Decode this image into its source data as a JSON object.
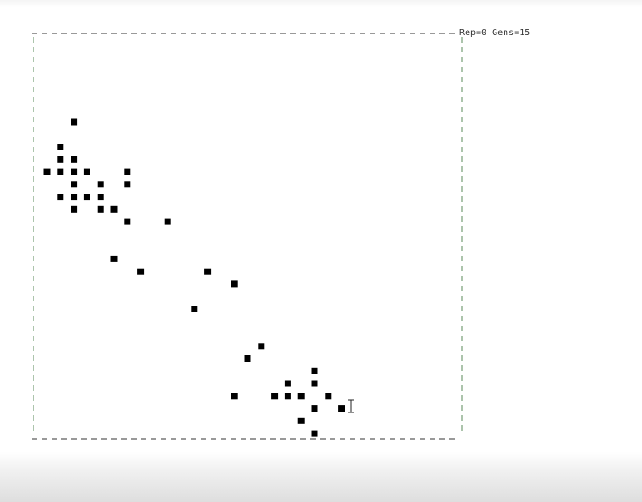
{
  "status": {
    "text": "Rep=0 Gens=15"
  },
  "colors": {
    "cell": "#000000",
    "border_side": "#5a8a5a",
    "border_horizontal": "#333333",
    "background": "#ffffff"
  },
  "board": {
    "live_cells": [
      [
        2,
        6
      ],
      [
        1,
        8
      ],
      [
        1,
        9
      ],
      [
        2,
        9
      ],
      [
        0,
        10
      ],
      [
        1,
        10
      ],
      [
        2,
        10
      ],
      [
        3,
        10
      ],
      [
        6,
        10
      ],
      [
        2,
        11
      ],
      [
        4,
        11
      ],
      [
        6,
        11
      ],
      [
        1,
        12
      ],
      [
        2,
        12
      ],
      [
        3,
        12
      ],
      [
        4,
        12
      ],
      [
        2,
        13
      ],
      [
        4,
        13
      ],
      [
        5,
        13
      ],
      [
        6,
        14
      ],
      [
        9,
        14
      ],
      [
        5,
        17
      ],
      [
        7,
        18
      ],
      [
        12,
        18
      ],
      [
        14,
        19
      ],
      [
        11,
        21
      ],
      [
        16,
        24
      ],
      [
        15,
        25
      ],
      [
        20,
        26
      ],
      [
        18,
        27
      ],
      [
        20,
        27
      ],
      [
        14,
        28
      ],
      [
        17,
        28
      ],
      [
        18,
        28
      ],
      [
        19,
        28
      ],
      [
        21,
        28
      ],
      [
        20,
        29
      ],
      [
        22,
        29
      ],
      [
        19,
        30
      ],
      [
        20,
        31
      ]
    ]
  },
  "cursor": {
    "icon": "text-cursor-icon"
  }
}
